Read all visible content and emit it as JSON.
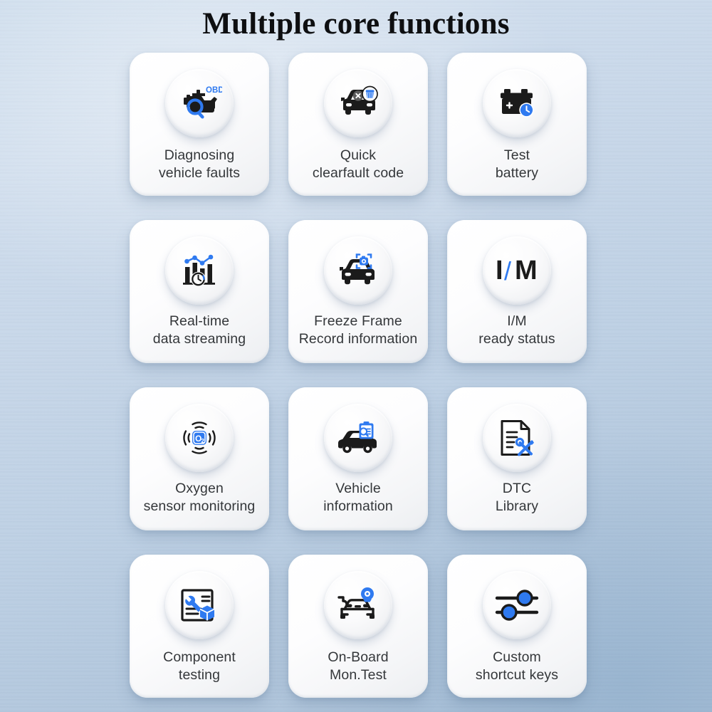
{
  "page": {
    "title": "Multiple core functions",
    "background_color": "#c3d4e6",
    "accent_color": "#3b82f6",
    "card_color": "#ffffff",
    "label_color": "#34373a"
  },
  "cards": [
    {
      "id": "diagnosing-vehicle-faults",
      "label": "Diagnosing\nvehicle faults",
      "icon": "engine-obd-scan-icon",
      "badge_text": "OBD"
    },
    {
      "id": "quick-clearfault-code",
      "label": "Quick\nclearfault code",
      "icon": "car-clear-fault-brush-icon",
      "badge_text": ""
    },
    {
      "id": "test-battery",
      "label": "Test\nbattery",
      "icon": "battery-clock-icon",
      "badge_text": ""
    },
    {
      "id": "real-time-data-streaming",
      "label": "Real-time\ndata streaming",
      "icon": "bar-chart-line-clock-icon",
      "badge_text": ""
    },
    {
      "id": "freeze-frame-record-information",
      "label": "Freeze Frame\nRecord information",
      "icon": "car-camera-frame-icon",
      "badge_text": ""
    },
    {
      "id": "im-ready-status",
      "label": "I/M\nready status",
      "icon": "im-text-icon",
      "badge_text": "I/M"
    },
    {
      "id": "oxygen-sensor-monitoring",
      "label": "Oxygen\nsensor monitoring",
      "icon": "o2-sensor-signal-icon",
      "badge_text": "O₂"
    },
    {
      "id": "vehicle-information",
      "label": "Vehicle\ninformation",
      "icon": "car-clipboard-info-icon",
      "badge_text": ""
    },
    {
      "id": "dtc-library",
      "label": "DTC\nLibrary",
      "icon": "document-tools-icon",
      "badge_text": ""
    },
    {
      "id": "component-testing",
      "label": "Component\ntesting",
      "icon": "document-wrench-box-icon",
      "badge_text": ""
    },
    {
      "id": "on-board-mon-test",
      "label": "On-Board\nMon.Test",
      "icon": "car-monitor-camera-icon",
      "badge_text": ""
    },
    {
      "id": "custom-shortcut-keys",
      "label": "Custom\nshortcut keys",
      "icon": "sliders-settings-icon",
      "badge_text": ""
    }
  ]
}
